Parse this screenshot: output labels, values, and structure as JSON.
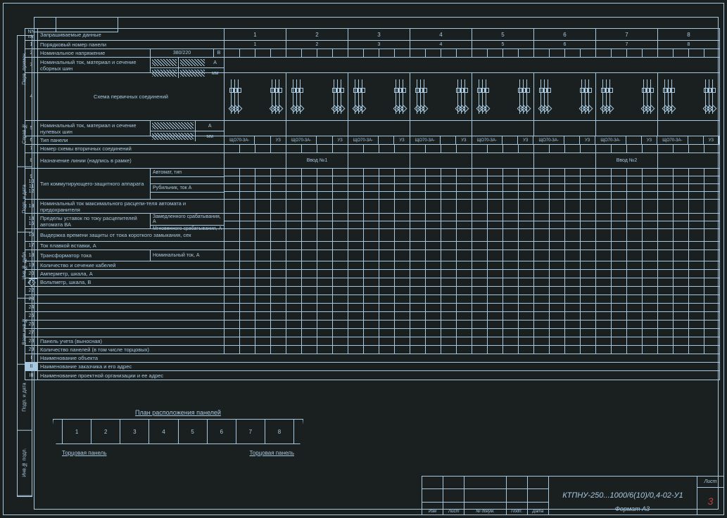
{
  "side_labels": [
    "Перв. примен.",
    "Справ.№",
    "Подп. и дата",
    "Инв.№ дубл.",
    "Взам.инв.№",
    "Подп. и дата",
    "Инв.№ подл."
  ],
  "header": {
    "nn": "NN п/п",
    "title": "Запрашиваемые данные",
    "panels": [
      "1",
      "2",
      "3",
      "4",
      "5",
      "6",
      "7",
      "8"
    ]
  },
  "rows": [
    {
      "n": "1",
      "desc": "Порядковый номер панели"
    },
    {
      "n": "2",
      "desc": "Номинальное напряжение",
      "val": "380/220",
      "unit": "В"
    },
    {
      "n": "3",
      "desc": "Номинальный ток, материал и сечение сборных шин",
      "u1": "А",
      "u2": "мм"
    },
    {
      "n": "4",
      "desc": "Схема первичных соединений"
    },
    {
      "n": "5",
      "desc": "Номинальный ток, материал и сечение нулевых шин",
      "u1": "А",
      "u2": "мм"
    },
    {
      "n": "6",
      "desc": "Тип панели",
      "subs": [
        "ЩО70-3А-",
        "УЗ"
      ]
    },
    {
      "n": "7",
      "desc": "Номер схемы вторичных соединений"
    },
    {
      "n": "8",
      "desc": "Назначение линии (надпись в рамке)",
      "inputs": {
        "2": "Ввод №1",
        "7": "Ввод №2"
      }
    },
    {
      "n": "9-12",
      "desc": "Тип коммутирующего-защитного аппарата",
      "s1": "Автомат, тип",
      "s2": "Рубильник, ток А"
    },
    {
      "n": "13",
      "desc": "Номинальный ток максимального расцепи-теля автомата и предохранителя"
    },
    {
      "n": "14-15",
      "desc": "Пределы уставок по току расцепителей автомата ВА",
      "s1": "Замедленного срабатывания, А",
      "s2": "Мгновенного срабатывания, А"
    },
    {
      "n": "16",
      "desc": "Выдержка времени защиты от тока короткого замыкания, сек"
    },
    {
      "n": "17",
      "desc": "Ток плавкой вставки, А"
    },
    {
      "n": "18",
      "desc": "Трансформатор тока",
      "s1": "Номинальный ток, А"
    },
    {
      "n": "19",
      "desc": "Количество и сечение кабелей"
    },
    {
      "n": "20",
      "desc": "Амперметр, шкала, А"
    },
    {
      "n": "21",
      "desc": "Вольтметр, шкала, В"
    },
    {
      "n": "22",
      "desc": ""
    },
    {
      "n": "23",
      "desc": ""
    },
    {
      "n": "24",
      "desc": ""
    },
    {
      "n": "25",
      "desc": ""
    },
    {
      "n": "26",
      "desc": ""
    },
    {
      "n": "27",
      "desc": ""
    },
    {
      "n": "28",
      "desc": "Панель учета (выносная)"
    },
    {
      "n": "29",
      "desc": "Количество панелей (в том числе торцовых)"
    },
    {
      "n": "I",
      "desc": "Наименование объекта"
    },
    {
      "n": "II",
      "desc": "Наименование заказчика и его адрес"
    },
    {
      "n": "III",
      "desc": "Наименование проектной организации и ее адрес"
    }
  ],
  "plan": {
    "title": "План расположения панелей",
    "cells": [
      "1",
      "2",
      "3",
      "4",
      "5",
      "6",
      "7",
      "8"
    ],
    "left": "Торцовая панель",
    "right": "Торцовая панель"
  },
  "title_block": {
    "cols": [
      "Изм",
      "Лист",
      "№ докум.",
      "Подп.",
      "Дата"
    ],
    "drawing": "КТПНУ-250...1000/6(10)/0,4-02-У1",
    "sheet_label": "Лист",
    "sheet": "3"
  },
  "format": "Формат А3"
}
